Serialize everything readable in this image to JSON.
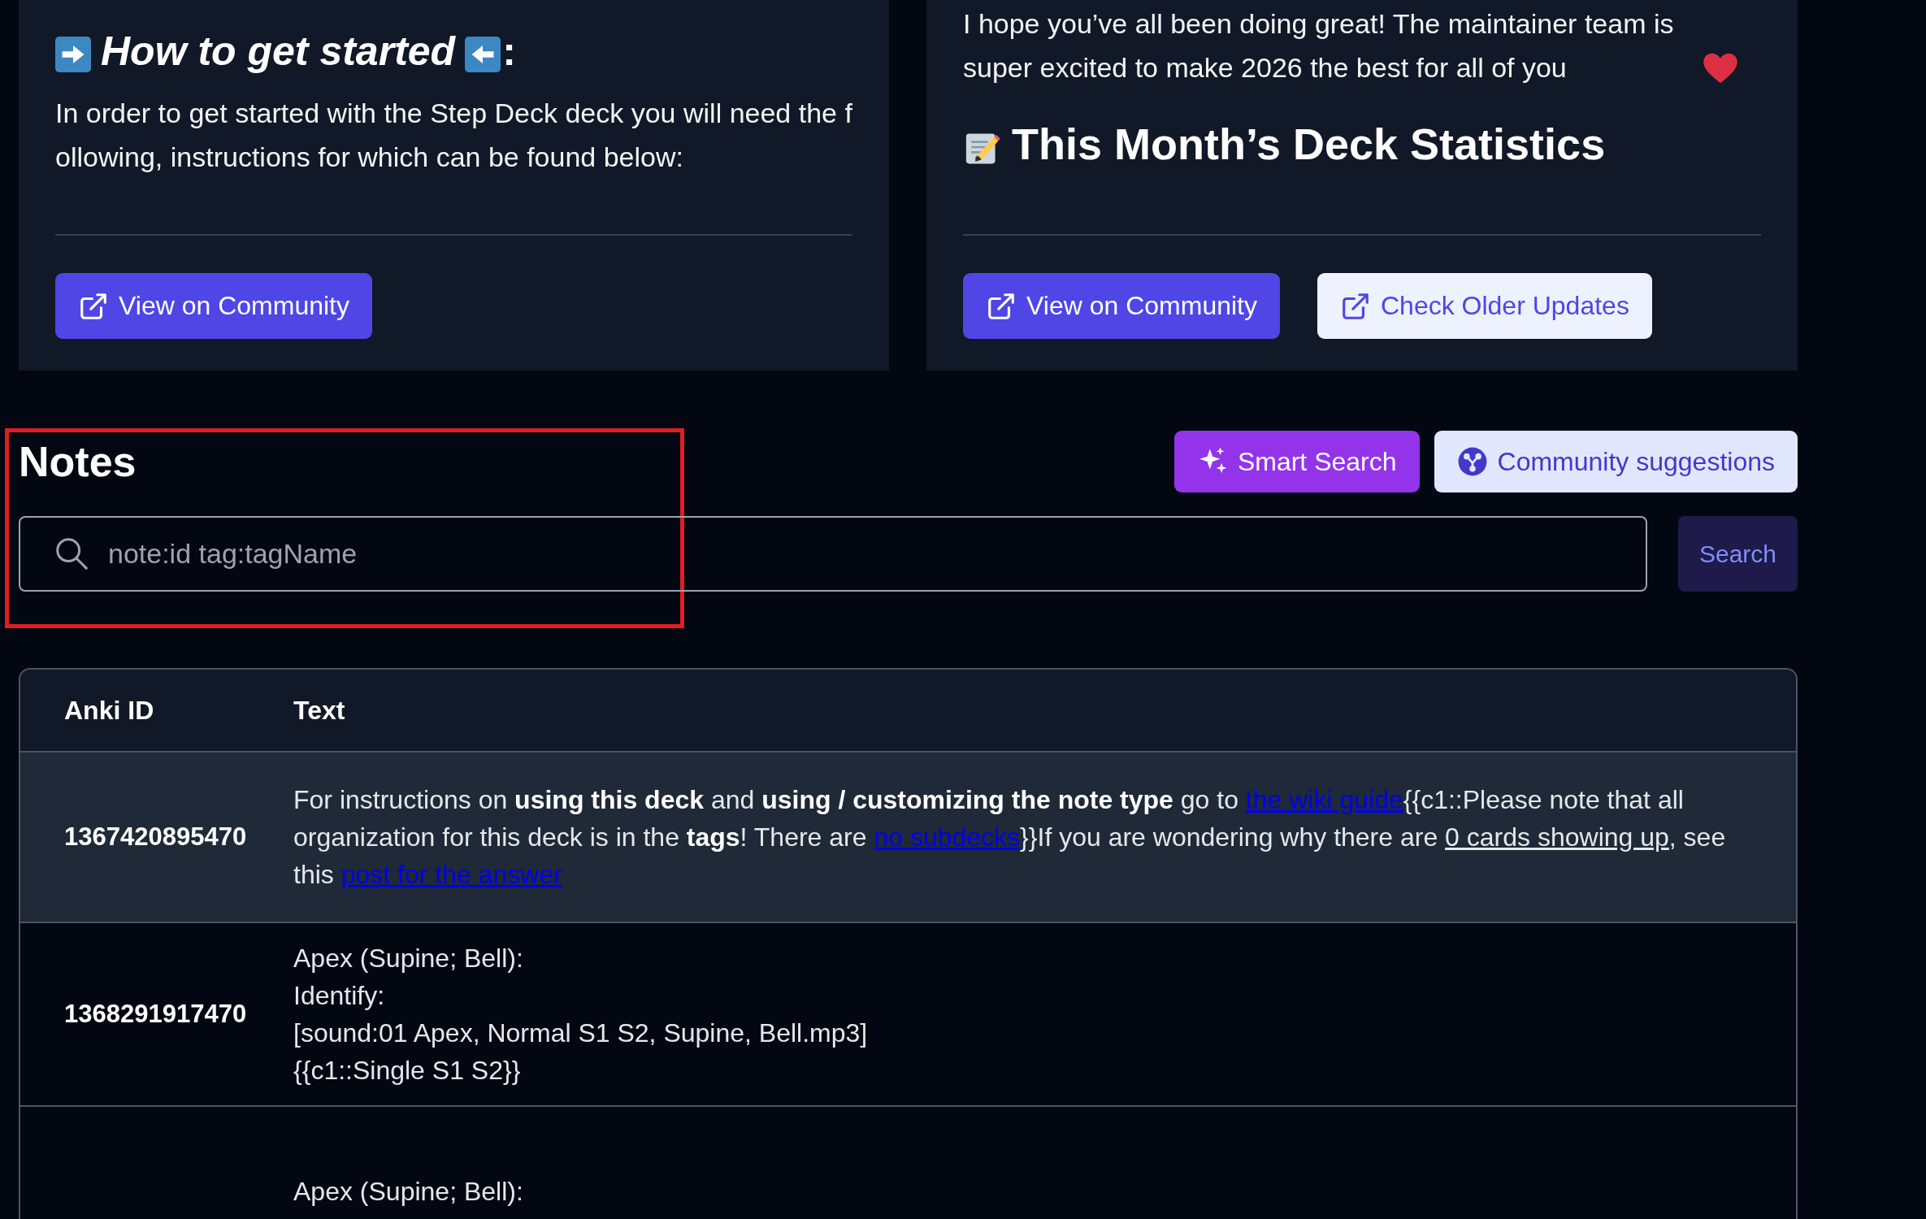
{
  "guide_card": {
    "heading": "How to get started",
    "heading_suffix": ":",
    "body": "In order to get started with the Step Deck deck you will need the following, instructions for which can be found below:",
    "buttons": [
      {
        "label": "View on Community",
        "kind": "primary"
      }
    ]
  },
  "news_card": {
    "body": "I hope you’ve all been doing great! The maintainer team is super excited to make 2026 the best for all of you",
    "heading": "This Month’s Deck Statistics",
    "buttons": [
      {
        "label": "View on Community",
        "kind": "primary"
      },
      {
        "label": "Check Older Updates",
        "kind": "secondary"
      }
    ]
  },
  "notes": {
    "title": "Notes",
    "actions": [
      {
        "label": "Smart Search",
        "kind": "smart"
      },
      {
        "label": "Community suggestions",
        "kind": "community"
      }
    ],
    "search": {
      "placeholder": "note:id tag:tagName",
      "button": "Search"
    },
    "table": {
      "columns": [
        "Anki ID",
        "Text"
      ],
      "rows": [
        {
          "id": "1367420895470",
          "highlighted": true,
          "lines": [
            [
              {
                "text": "For instructions on ",
                "kind": "plain"
              },
              {
                "text": "using this deck",
                "kind": "bold"
              },
              {
                "text": " and ",
                "kind": "plain"
              },
              {
                "text": "using / customizing the note type",
                "kind": "bold"
              },
              {
                "text": " go to ",
                "kind": "plain"
              },
              {
                "text": "the wiki guide",
                "kind": "link"
              },
              {
                "text": "{{c1::Please note that all organization for this deck is in the ",
                "kind": "plain"
              },
              {
                "text": "tags",
                "kind": "bold"
              },
              {
                "text": "! There are ",
                "kind": "plain"
              },
              {
                "text": "no subdecks",
                "kind": "link"
              },
              {
                "text": "}}If you are wondering why there are ",
                "kind": "plain"
              },
              {
                "text": "0 cards showing up",
                "kind": "underline"
              },
              {
                "text": ", see this ",
                "kind": "plain"
              },
              {
                "text": "post for the answer",
                "kind": "link"
              }
            ]
          ]
        },
        {
          "id": "1368291917470",
          "highlighted": false,
          "lines": [
            [
              {
                "text": "Apex (Supine; Bell):",
                "kind": "plain"
              }
            ],
            [
              {
                "text": "Identify:",
                "kind": "plain"
              }
            ],
            [
              {
                "text": "[sound:01 Apex, Normal S1 S2, Supine, Bell.mp3]",
                "kind": "plain"
              }
            ],
            [
              {
                "text": "{{c1::Single S1 S2}}",
                "kind": "plain"
              }
            ]
          ]
        },
        {
          "highlighted": false,
          "lines": [
            [
              {
                "text": "Apex (Supine; Bell):",
                "kind": "plain"
              }
            ]
          ]
        }
      ]
    }
  }
}
